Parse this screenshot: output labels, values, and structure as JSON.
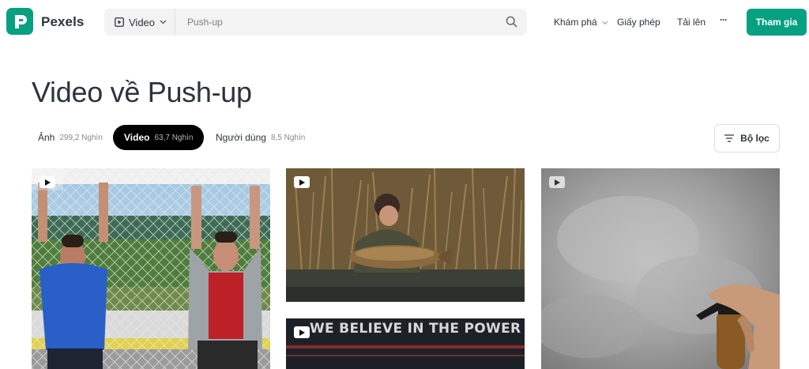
{
  "brand": {
    "name": "Pexels",
    "color": "#07a081"
  },
  "search": {
    "type_label": "Video",
    "placeholder": "Push-up"
  },
  "nav": {
    "explore": "Khám phá",
    "license": "Giấy phép",
    "upload": "Tải lên",
    "more": "···",
    "join": "Tham gia"
  },
  "title": "Video về Push-up",
  "tabs": [
    {
      "label": "Ảnh",
      "count": "299,2 Nghìn",
      "active": false
    },
    {
      "label": "Video",
      "count": "63,7 Nghìn",
      "active": true
    },
    {
      "label": "Người dùng",
      "count": "8,5 Nghìn",
      "active": false
    }
  ],
  "filter_label": "Bộ lọc",
  "videos": [
    {
      "subject": "men-hanging-on-goal-net"
    },
    {
      "subject": "fisherman-holding-carp"
    },
    {
      "subject": "spray-bottle-clouds"
    },
    {
      "subject": "banner",
      "banner_text": "WE BELIEVE IN THE POWER OF"
    }
  ],
  "icons": {
    "play": "play-icon",
    "search": "search-icon",
    "filter": "filter-icon"
  }
}
